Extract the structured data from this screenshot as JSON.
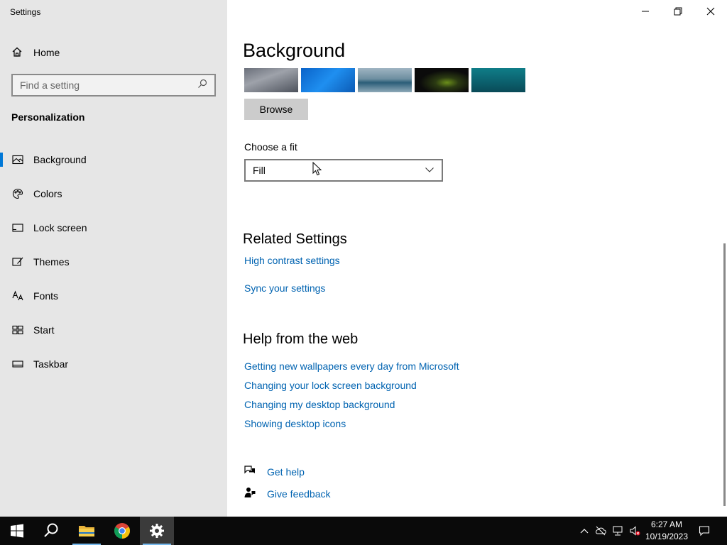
{
  "window": {
    "title": "Settings"
  },
  "sidebar": {
    "home_label": "Home",
    "search_placeholder": "Find a setting",
    "section_label": "Personalization",
    "items": [
      {
        "label": "Background",
        "icon": "picture-icon"
      },
      {
        "label": "Colors",
        "icon": "palette-icon"
      },
      {
        "label": "Lock screen",
        "icon": "lock-screen-icon"
      },
      {
        "label": "Themes",
        "icon": "brush-icon"
      },
      {
        "label": "Fonts",
        "icon": "font-icon"
      },
      {
        "label": "Start",
        "icon": "start-layout-icon"
      },
      {
        "label": "Taskbar",
        "icon": "taskbar-icon"
      }
    ],
    "active_index": 0
  },
  "main": {
    "title": "Background",
    "browse_label": "Browse",
    "fit_label": "Choose a fit",
    "fit_value": "Fill",
    "related_heading": "Related Settings",
    "related_links": [
      "High contrast settings",
      "Sync your settings"
    ],
    "help_heading": "Help from the web",
    "help_links": [
      "Getting new wallpapers every day from Microsoft",
      "Changing your lock screen background",
      "Changing my desktop background",
      "Showing desktop icons"
    ],
    "get_help": "Get help",
    "give_feedback": "Give feedback"
  },
  "taskbar": {
    "time": "6:27 AM",
    "date": "10/19/2023"
  },
  "colors": {
    "accent": "#0078d7",
    "link": "#0063b1",
    "sidebar_bg": "#e6e6e6",
    "taskbar_bg": "#0a0a0a"
  }
}
